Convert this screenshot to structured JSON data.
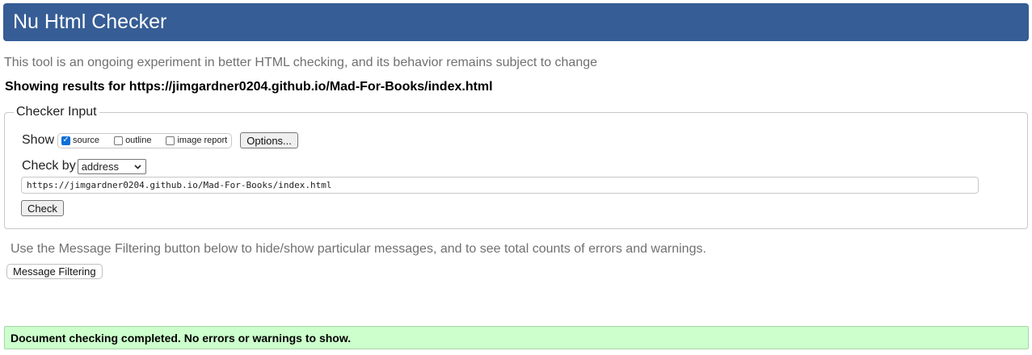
{
  "header": {
    "title": "Nu Html Checker",
    "accent_color": "#365d95"
  },
  "intro": "This tool is an ongoing experiment in better HTML checking, and its behavior remains subject to change",
  "results_heading": "Showing results for https://jimgardner0204.github.io/Mad-For-Books/index.html",
  "checker_input": {
    "legend": "Checker Input",
    "show_label": "Show",
    "options": [
      {
        "label": "source",
        "checked": true
      },
      {
        "label": "outline",
        "checked": false
      },
      {
        "label": "image report",
        "checked": false
      }
    ],
    "options_button": "Options...",
    "check_by_label": "Check by",
    "check_by_value": "address",
    "url_value": "https://jimgardner0204.github.io/Mad-For-Books/index.html",
    "check_button": "Check"
  },
  "message_filtering": {
    "intro": "Use the Message Filtering button below to hide/show particular messages, and to see total counts of errors and warnings.",
    "button": "Message Filtering"
  },
  "result": {
    "message": "Document checking completed. No errors or warnings to show.",
    "status_color": "#ccffcc"
  }
}
